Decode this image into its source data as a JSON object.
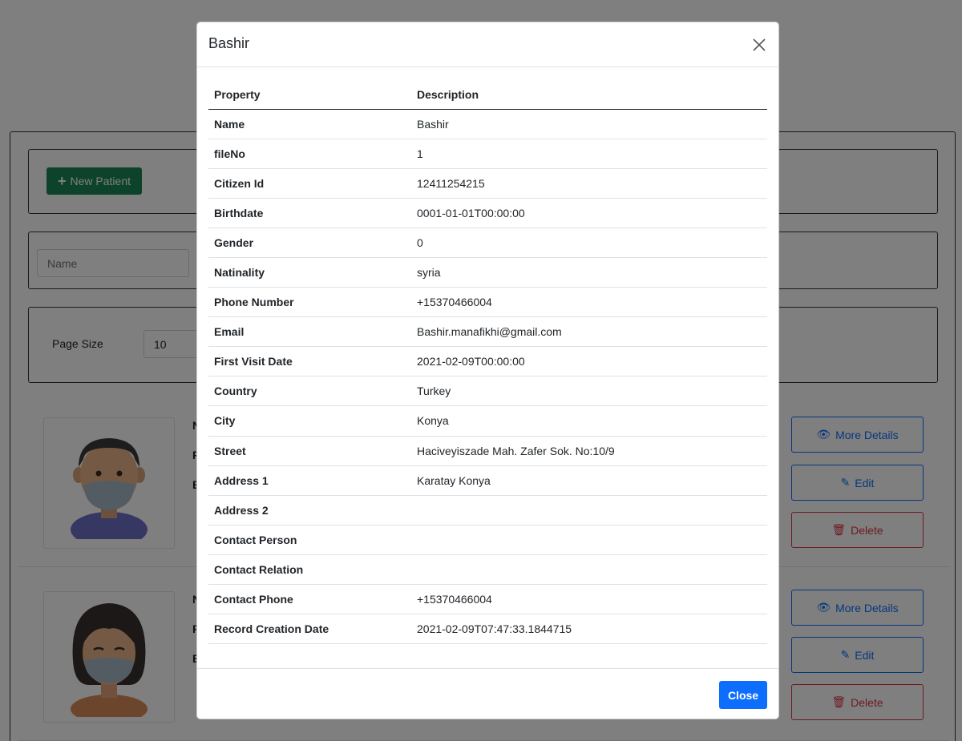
{
  "background": {
    "new_patient_label": "New Patient",
    "search": {
      "placeholder": "Name"
    },
    "paging": {
      "label": "Page Size",
      "value": "10"
    },
    "cards": [
      {
        "letters": [
          "N",
          "F",
          "E"
        ],
        "more_label": "More Details",
        "edit_label": "Edit",
        "delete_label": "Delete"
      },
      {
        "letters": [
          "N",
          "F",
          "E"
        ],
        "more_label": "More Details",
        "edit_label": "Edit",
        "delete_label": "Delete"
      }
    ]
  },
  "modal": {
    "title": "Bashir",
    "columns": {
      "property": "Property",
      "description": "Description"
    },
    "rows": [
      {
        "property": "Name",
        "value": "Bashir"
      },
      {
        "property": "fileNo",
        "value": "1"
      },
      {
        "property": "Citizen Id",
        "value": "12411254215"
      },
      {
        "property": "Birthdate",
        "value": "0001-01-01T00:00:00"
      },
      {
        "property": "Gender",
        "value": "0"
      },
      {
        "property": "Natinality",
        "value": "syria"
      },
      {
        "property": "Phone Number",
        "value": "+15370466004"
      },
      {
        "property": "Email",
        "value": "Bashir.manafikhi@gmail.com"
      },
      {
        "property": "First Visit Date",
        "value": "2021-02-09T00:00:00"
      },
      {
        "property": "Country",
        "value": "Turkey"
      },
      {
        "property": "City",
        "value": "Konya"
      },
      {
        "property": "Street",
        "value": "Haciveyiszade Mah. Zafer Sok. No:10/9"
      },
      {
        "property": "Address 1",
        "value": "Karatay Konya"
      },
      {
        "property": "Address 2",
        "value": ""
      },
      {
        "property": "Contact Person",
        "value": ""
      },
      {
        "property": "Contact Relation",
        "value": ""
      },
      {
        "property": "Contact Phone",
        "value": "+15370466004"
      },
      {
        "property": "Record Creation Date",
        "value": "2021-02-09T07:47:33.1844715"
      }
    ],
    "close_label": "Close"
  },
  "colors": {
    "primary": "#0d6efd",
    "success": "#198754",
    "danger": "#dc3545"
  }
}
